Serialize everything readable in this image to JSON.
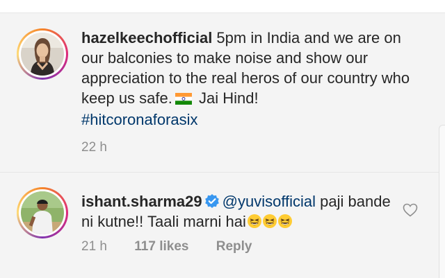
{
  "comments": [
    {
      "username": "hazelkeechofficial",
      "text_part1": " 5pm in India and we are on our balconies to make noise and show our appreciation to the real heros of our country who keep us safe.",
      "flag_emoji": "india-flag",
      "text_part2": " Jai Hind!",
      "hashtag": "#hitcoronaforasix",
      "time": "22 h",
      "avatar_icon": "profile-photo-woman"
    },
    {
      "username": "ishant.sharma29",
      "verified": true,
      "mention": "@yuvisofficial",
      "text": " paji bande ni kutne!! Taali marni hai",
      "emoji": "laughing-emoji",
      "emoji_count": 3,
      "time": "21 h",
      "likes": "117 likes",
      "reply_label": "Reply",
      "avatar_icon": "profile-photo-cricketer"
    }
  ],
  "colors": {
    "background": "#f4f4f4",
    "text": "#262626",
    "meta": "#8e8e8e",
    "link": "#00376b",
    "verified": "#3897f0"
  },
  "icons": {
    "like": "heart-outline-icon",
    "verified": "verified-badge-icon"
  }
}
